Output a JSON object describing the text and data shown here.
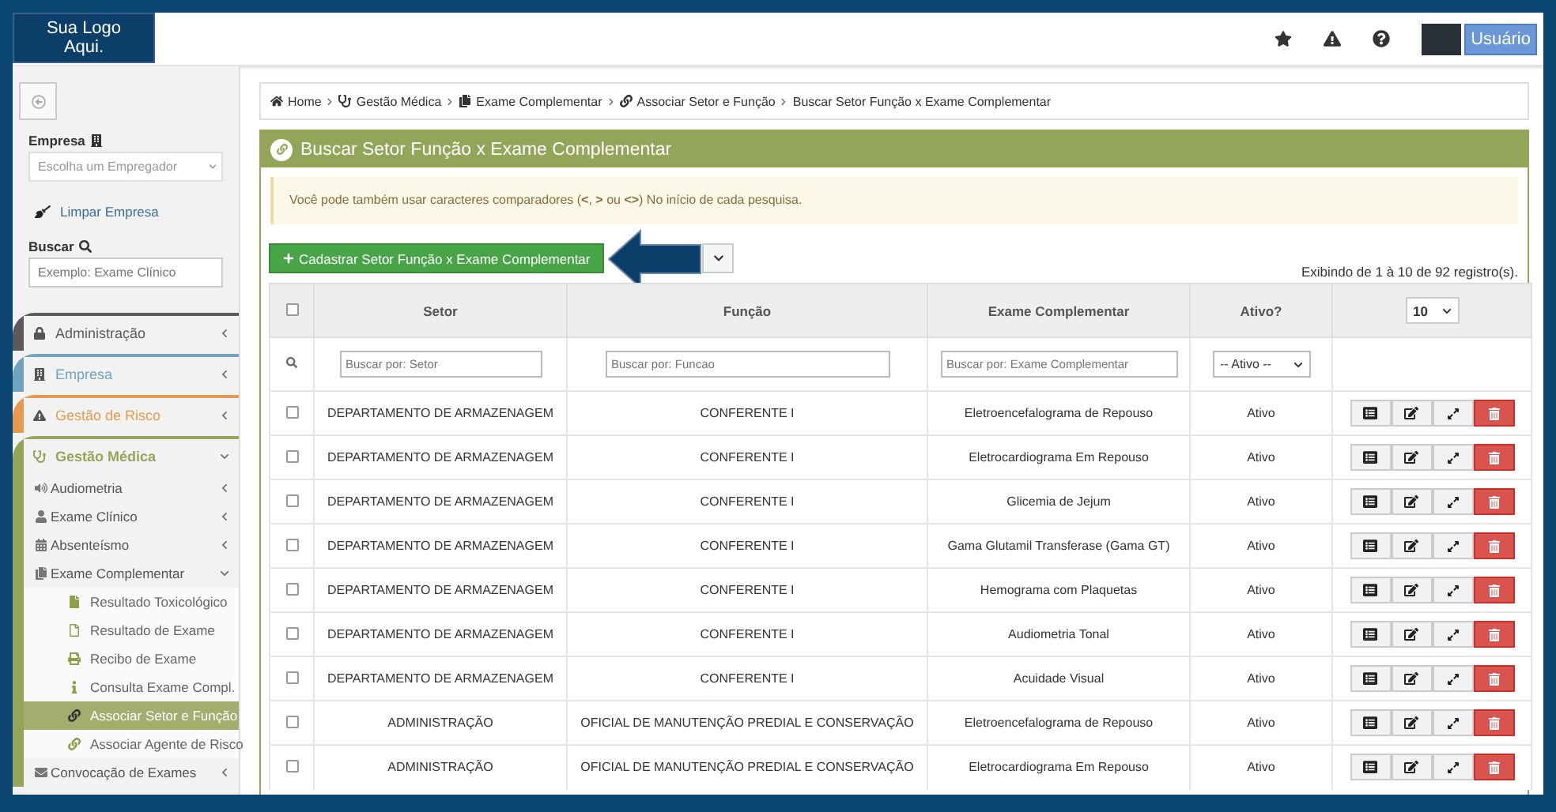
{
  "logo": {
    "text": "Sua Logo Aqui."
  },
  "topbar": {
    "user_button": "Usuário"
  },
  "sidebar": {
    "company_label": "Empresa",
    "company_select": {
      "placeholder": "Escolha um Empregador"
    },
    "clear_link": "Limpar Empresa",
    "search_label": "Buscar",
    "search": {
      "placeholder": "Exemplo: Exame Clínico"
    },
    "menu": [
      {
        "label": "Administração",
        "color": "#5b5b5b",
        "expanded": false
      },
      {
        "label": "Empresa",
        "color": "#6fa3bf",
        "expanded": false
      },
      {
        "label": "Gestão de Risco",
        "color": "#e59a4e",
        "expanded": false
      },
      {
        "label": "Gestão Médica",
        "color": "#94a55a",
        "expanded": true,
        "children": [
          {
            "label": "Audiometria",
            "expanded": false
          },
          {
            "label": "Exame Clínico",
            "expanded": false
          },
          {
            "label": "Absenteísmo",
            "expanded": false
          },
          {
            "label": "Exame Complementar",
            "expanded": true,
            "children": [
              {
                "label": "Resultado Toxicológico",
                "selected": false
              },
              {
                "label": "Resultado de Exame",
                "selected": false
              },
              {
                "label": "Recibo de Exame",
                "selected": false
              },
              {
                "label": "Consulta Exame Compl.",
                "selected": false
              },
              {
                "label": "Associar Setor e Função",
                "selected": true
              },
              {
                "label": "Associar Agente de Risco",
                "selected": false
              }
            ]
          },
          {
            "label": "Convocação de Exames",
            "expanded": false
          }
        ]
      }
    ]
  },
  "breadcrumb": [
    "Home",
    "Gestão Médica",
    "Exame Complementar",
    "Associar Setor e Função",
    "Buscar Setor Função x Exame Complementar"
  ],
  "panel": {
    "title": "Buscar Setor Função x Exame Complementar",
    "alert": "Você pode também usar caracteres comparadores (**<**, **>** ou **<>**) No início de cada pesquisa.",
    "add_button": "Cadastrar Setor Função x Exame Complementar",
    "records_info": "Exibindo de 1 à 10 de 92 registro(s).",
    "table": {
      "select_all": {
        "checked": false
      },
      "columns": [
        "Setor",
        "Função",
        "Exame Complementar",
        "Ativo?"
      ],
      "page_size": "10",
      "filters": [
        {
          "kind": "text",
          "placeholder": "Buscar por: Setor"
        },
        {
          "kind": "text",
          "placeholder": "Buscar por: Funcao"
        },
        {
          "kind": "text",
          "placeholder": "Buscar por: Exame Complementar"
        },
        {
          "kind": "select",
          "value": "-- Ativo --"
        }
      ],
      "rows": [
        {
          "checked": false,
          "setor": "DEPARTAMENTO DE ARMAZENAGEM",
          "funcao": "CONFERENTE I",
          "exame": "Eletroencefalograma de Repouso",
          "ativo": "Ativo"
        },
        {
          "checked": false,
          "setor": "DEPARTAMENTO DE ARMAZENAGEM",
          "funcao": "CONFERENTE I",
          "exame": "Eletrocardiograma Em Repouso",
          "ativo": "Ativo"
        },
        {
          "checked": false,
          "setor": "DEPARTAMENTO DE ARMAZENAGEM",
          "funcao": "CONFERENTE I",
          "exame": "Glicemia de Jejum",
          "ativo": "Ativo"
        },
        {
          "checked": false,
          "setor": "DEPARTAMENTO DE ARMAZENAGEM",
          "funcao": "CONFERENTE I",
          "exame": "Gama Glutamil Transferase (Gama GT)",
          "ativo": "Ativo"
        },
        {
          "checked": false,
          "setor": "DEPARTAMENTO DE ARMAZENAGEM",
          "funcao": "CONFERENTE I",
          "exame": "Hemograma com Plaquetas",
          "ativo": "Ativo"
        },
        {
          "checked": false,
          "setor": "DEPARTAMENTO DE ARMAZENAGEM",
          "funcao": "CONFERENTE I",
          "exame": "Audiometria Tonal",
          "ativo": "Ativo"
        },
        {
          "checked": false,
          "setor": "DEPARTAMENTO DE ARMAZENAGEM",
          "funcao": "CONFERENTE I",
          "exame": "Acuidade Visual",
          "ativo": "Ativo"
        },
        {
          "checked": false,
          "setor": "ADMINISTRAÇÃO",
          "funcao": "OFICIAL DE MANUTENÇÃO PREDIAL E CONSERVAÇÃO",
          "exame": "Eletroencefalograma de Repouso",
          "ativo": "Ativo"
        },
        {
          "checked": false,
          "setor": "ADMINISTRAÇÃO",
          "funcao": "OFICIAL DE MANUTENÇÃO PREDIAL E CONSERVAÇÃO",
          "exame": "Eletrocardiograma Em Repouso",
          "ativo": "Ativo"
        }
      ]
    }
  }
}
